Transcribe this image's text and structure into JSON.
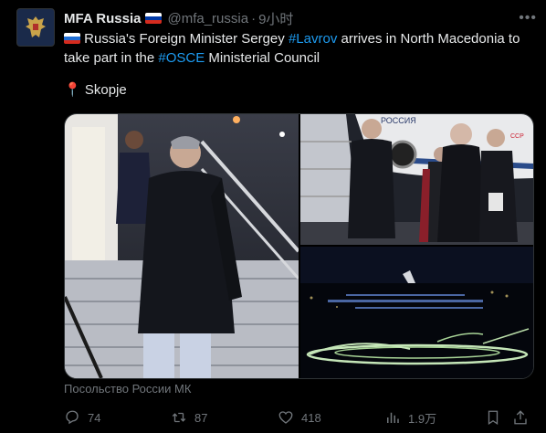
{
  "author": {
    "name": "MFA Russia",
    "handle": "@mfa_russia",
    "separator": "·",
    "time": "9小时"
  },
  "tweet": {
    "line_prefix": " Russia's Foreign Minister Sergey ",
    "hashtag1": "#Lavrov",
    "mid": " arrives in North Macedonia to take part in the ",
    "hashtag2": "#OSCE",
    "suffix": " Ministerial Council",
    "location": "Skopje"
  },
  "media": {
    "credit": "Посольство России МК",
    "plane_text": "РОССИЯ",
    "plane_sign": "CCP"
  },
  "actions": {
    "replies": "74",
    "reposts": "87",
    "likes": "418",
    "views": "1.9万"
  },
  "colors": {
    "background": "#000000",
    "text": "#e7e9ea",
    "muted": "#71767b",
    "link": "#1d9bf0"
  }
}
